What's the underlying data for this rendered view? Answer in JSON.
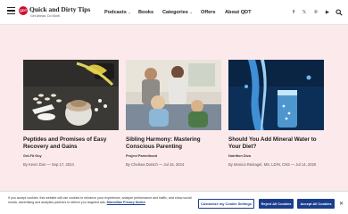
{
  "header": {
    "logo_mark": "QDT",
    "logo_title": "Quick and Dirty Tips",
    "logo_subtitle": "Get Ahead. Do More.",
    "nav": [
      {
        "label": "Podcasts",
        "has_dropdown": true
      },
      {
        "label": "Books",
        "has_dropdown": false
      },
      {
        "label": "Categories",
        "has_dropdown": true
      },
      {
        "label": "Offers",
        "has_dropdown": false
      },
      {
        "label": "About QDT",
        "has_dropdown": false
      }
    ],
    "social": {
      "facebook": "f",
      "x": "𝕏",
      "pinterest": "℗",
      "youtube": "▶"
    }
  },
  "cards": [
    {
      "title": "Peptides and Promises of Easy Recovery and Gains",
      "tag": "Get-Fit Guy",
      "meta": "By Kevin Don — Sep 17, 2024"
    },
    {
      "title": "Sibling Harmony: Mastering Conscious Parenting",
      "tag": "Project Parenthood",
      "meta": "By Chelsea Dorsch — Jul 15, 2024"
    },
    {
      "title": "Should You Add Mineral Water to Your Diet?",
      "tag": "Nutrition Diva",
      "meta": "By Monica Reinagel, MS, LD/N, CNS — Jul 14, 2020"
    }
  ],
  "cookie": {
    "text": "If you accept cookies, this website will use cookies to enhance your experience, analyze performance and traffic, and show social media, advertising and analytics partners to deliver you targeted ads.",
    "policy_link": "Macmillan Privacy Notice",
    "customize_label": "Customize my Cookie Settings",
    "reject_label": "Reject All Cookies",
    "accept_label": "Accept All Cookies",
    "close_glyph": "✕"
  },
  "colors": {
    "page_background": "#fbe9eb",
    "brand_red": "#c8102e",
    "button_blue": "#1a3e8c"
  }
}
